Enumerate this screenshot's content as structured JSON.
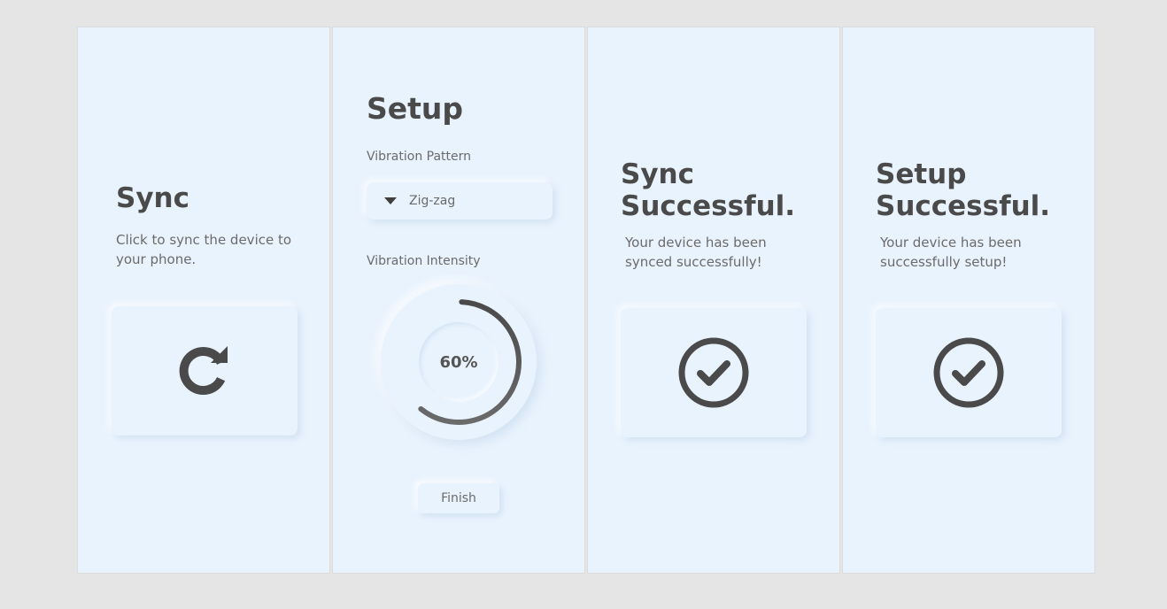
{
  "sync_panel": {
    "title": "Sync",
    "description": "Click to sync the device to your phone.",
    "icon": "refresh-icon"
  },
  "setup_panel": {
    "title": "Setup",
    "pattern_label": "Vibration Pattern",
    "pattern_value": "Zig-zag",
    "intensity_label": "Vibration Intensity",
    "intensity_value": "60%",
    "intensity_fraction": 0.6,
    "finish_label": "Finish"
  },
  "sync_success_panel": {
    "title_line1": "Sync",
    "title_line2": "Successful.",
    "description": "Your device has been synced successfully!",
    "icon": "check-circle-icon"
  },
  "setup_success_panel": {
    "title_line1": "Setup",
    "title_line2": "Successful.",
    "description": "Your device has been successfully setup!",
    "icon": "check-circle-icon"
  },
  "colors": {
    "background": "#e5e5e5",
    "panel": "#e9f3fd",
    "text_dark": "#4a4a4a",
    "text_muted": "#6b6b6b"
  }
}
